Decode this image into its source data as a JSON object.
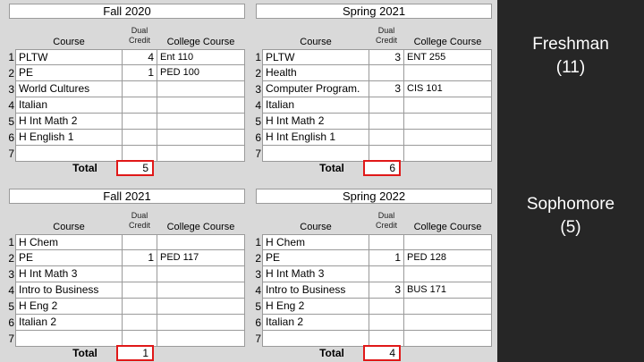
{
  "column_headers": {
    "course": "Course",
    "dual_line1": "Dual",
    "dual_line2": "Credit",
    "college": "College Course"
  },
  "total_label": "Total",
  "panels": [
    {
      "title": "Fall 2020",
      "rows": [
        {
          "n": "1",
          "course": "PLTW",
          "dual": "4",
          "college": "Ent 110"
        },
        {
          "n": "2",
          "course": "PE",
          "dual": "1",
          "college": "PED 100"
        },
        {
          "n": "3",
          "course": "World Cultures",
          "dual": "",
          "college": ""
        },
        {
          "n": "4",
          "course": "Italian",
          "dual": "",
          "college": ""
        },
        {
          "n": "5",
          "course": "H Int Math 2",
          "dual": "",
          "college": ""
        },
        {
          "n": "6",
          "course": "H English 1",
          "dual": "",
          "college": ""
        },
        {
          "n": "7",
          "course": "",
          "dual": "",
          "college": ""
        }
      ],
      "total": "5"
    },
    {
      "title": "Spring 2021",
      "rows": [
        {
          "n": "1",
          "course": "PLTW",
          "dual": "3",
          "college": "ENT 255"
        },
        {
          "n": "2",
          "course": "Health",
          "dual": "",
          "college": ""
        },
        {
          "n": "3",
          "course": "Computer Program.",
          "dual": "3",
          "college": "CIS 101"
        },
        {
          "n": "4",
          "course": "Italian",
          "dual": "",
          "college": ""
        },
        {
          "n": "5",
          "course": "H Int Math 2",
          "dual": "",
          "college": ""
        },
        {
          "n": "6",
          "course": "H Int English 1",
          "dual": "",
          "college": ""
        },
        {
          "n": "7",
          "course": "",
          "dual": "",
          "college": ""
        }
      ],
      "total": "6"
    },
    {
      "title": "Fall 2021",
      "rows": [
        {
          "n": "1",
          "course": "H Chem",
          "dual": "",
          "college": ""
        },
        {
          "n": "2",
          "course": "PE",
          "dual": "1",
          "college": "PED 117"
        },
        {
          "n": "3",
          "course": "H Int Math 3",
          "dual": "",
          "college": ""
        },
        {
          "n": "4",
          "course": "Intro to Business",
          "dual": "",
          "college": ""
        },
        {
          "n": "5",
          "course": "H Eng 2",
          "dual": "",
          "college": ""
        },
        {
          "n": "6",
          "course": "Italian 2",
          "dual": "",
          "college": ""
        },
        {
          "n": "7",
          "course": "",
          "dual": "",
          "college": ""
        }
      ],
      "total": "1"
    },
    {
      "title": "Spring 2022",
      "rows": [
        {
          "n": "1",
          "course": "H Chem",
          "dual": "",
          "college": ""
        },
        {
          "n": "2",
          "course": "PE",
          "dual": "1",
          "college": "PED 128"
        },
        {
          "n": "3",
          "course": "H Int Math 3",
          "dual": "",
          "college": ""
        },
        {
          "n": "4",
          "course": "Intro to Business",
          "dual": "3",
          "college": "BUS 171"
        },
        {
          "n": "5",
          "course": "H Eng 2",
          "dual": "",
          "college": ""
        },
        {
          "n": "6",
          "course": "Italian 2",
          "dual": "",
          "college": ""
        },
        {
          "n": "7",
          "course": "",
          "dual": "",
          "college": ""
        }
      ],
      "total": "4"
    }
  ],
  "side": {
    "freshman": "Freshman",
    "freshman_count": "(11)",
    "sophomore": "Sophomore",
    "sophomore_count": "(5)"
  },
  "colors": {
    "total_border": "#e01818",
    "side_bg": "#262626"
  }
}
